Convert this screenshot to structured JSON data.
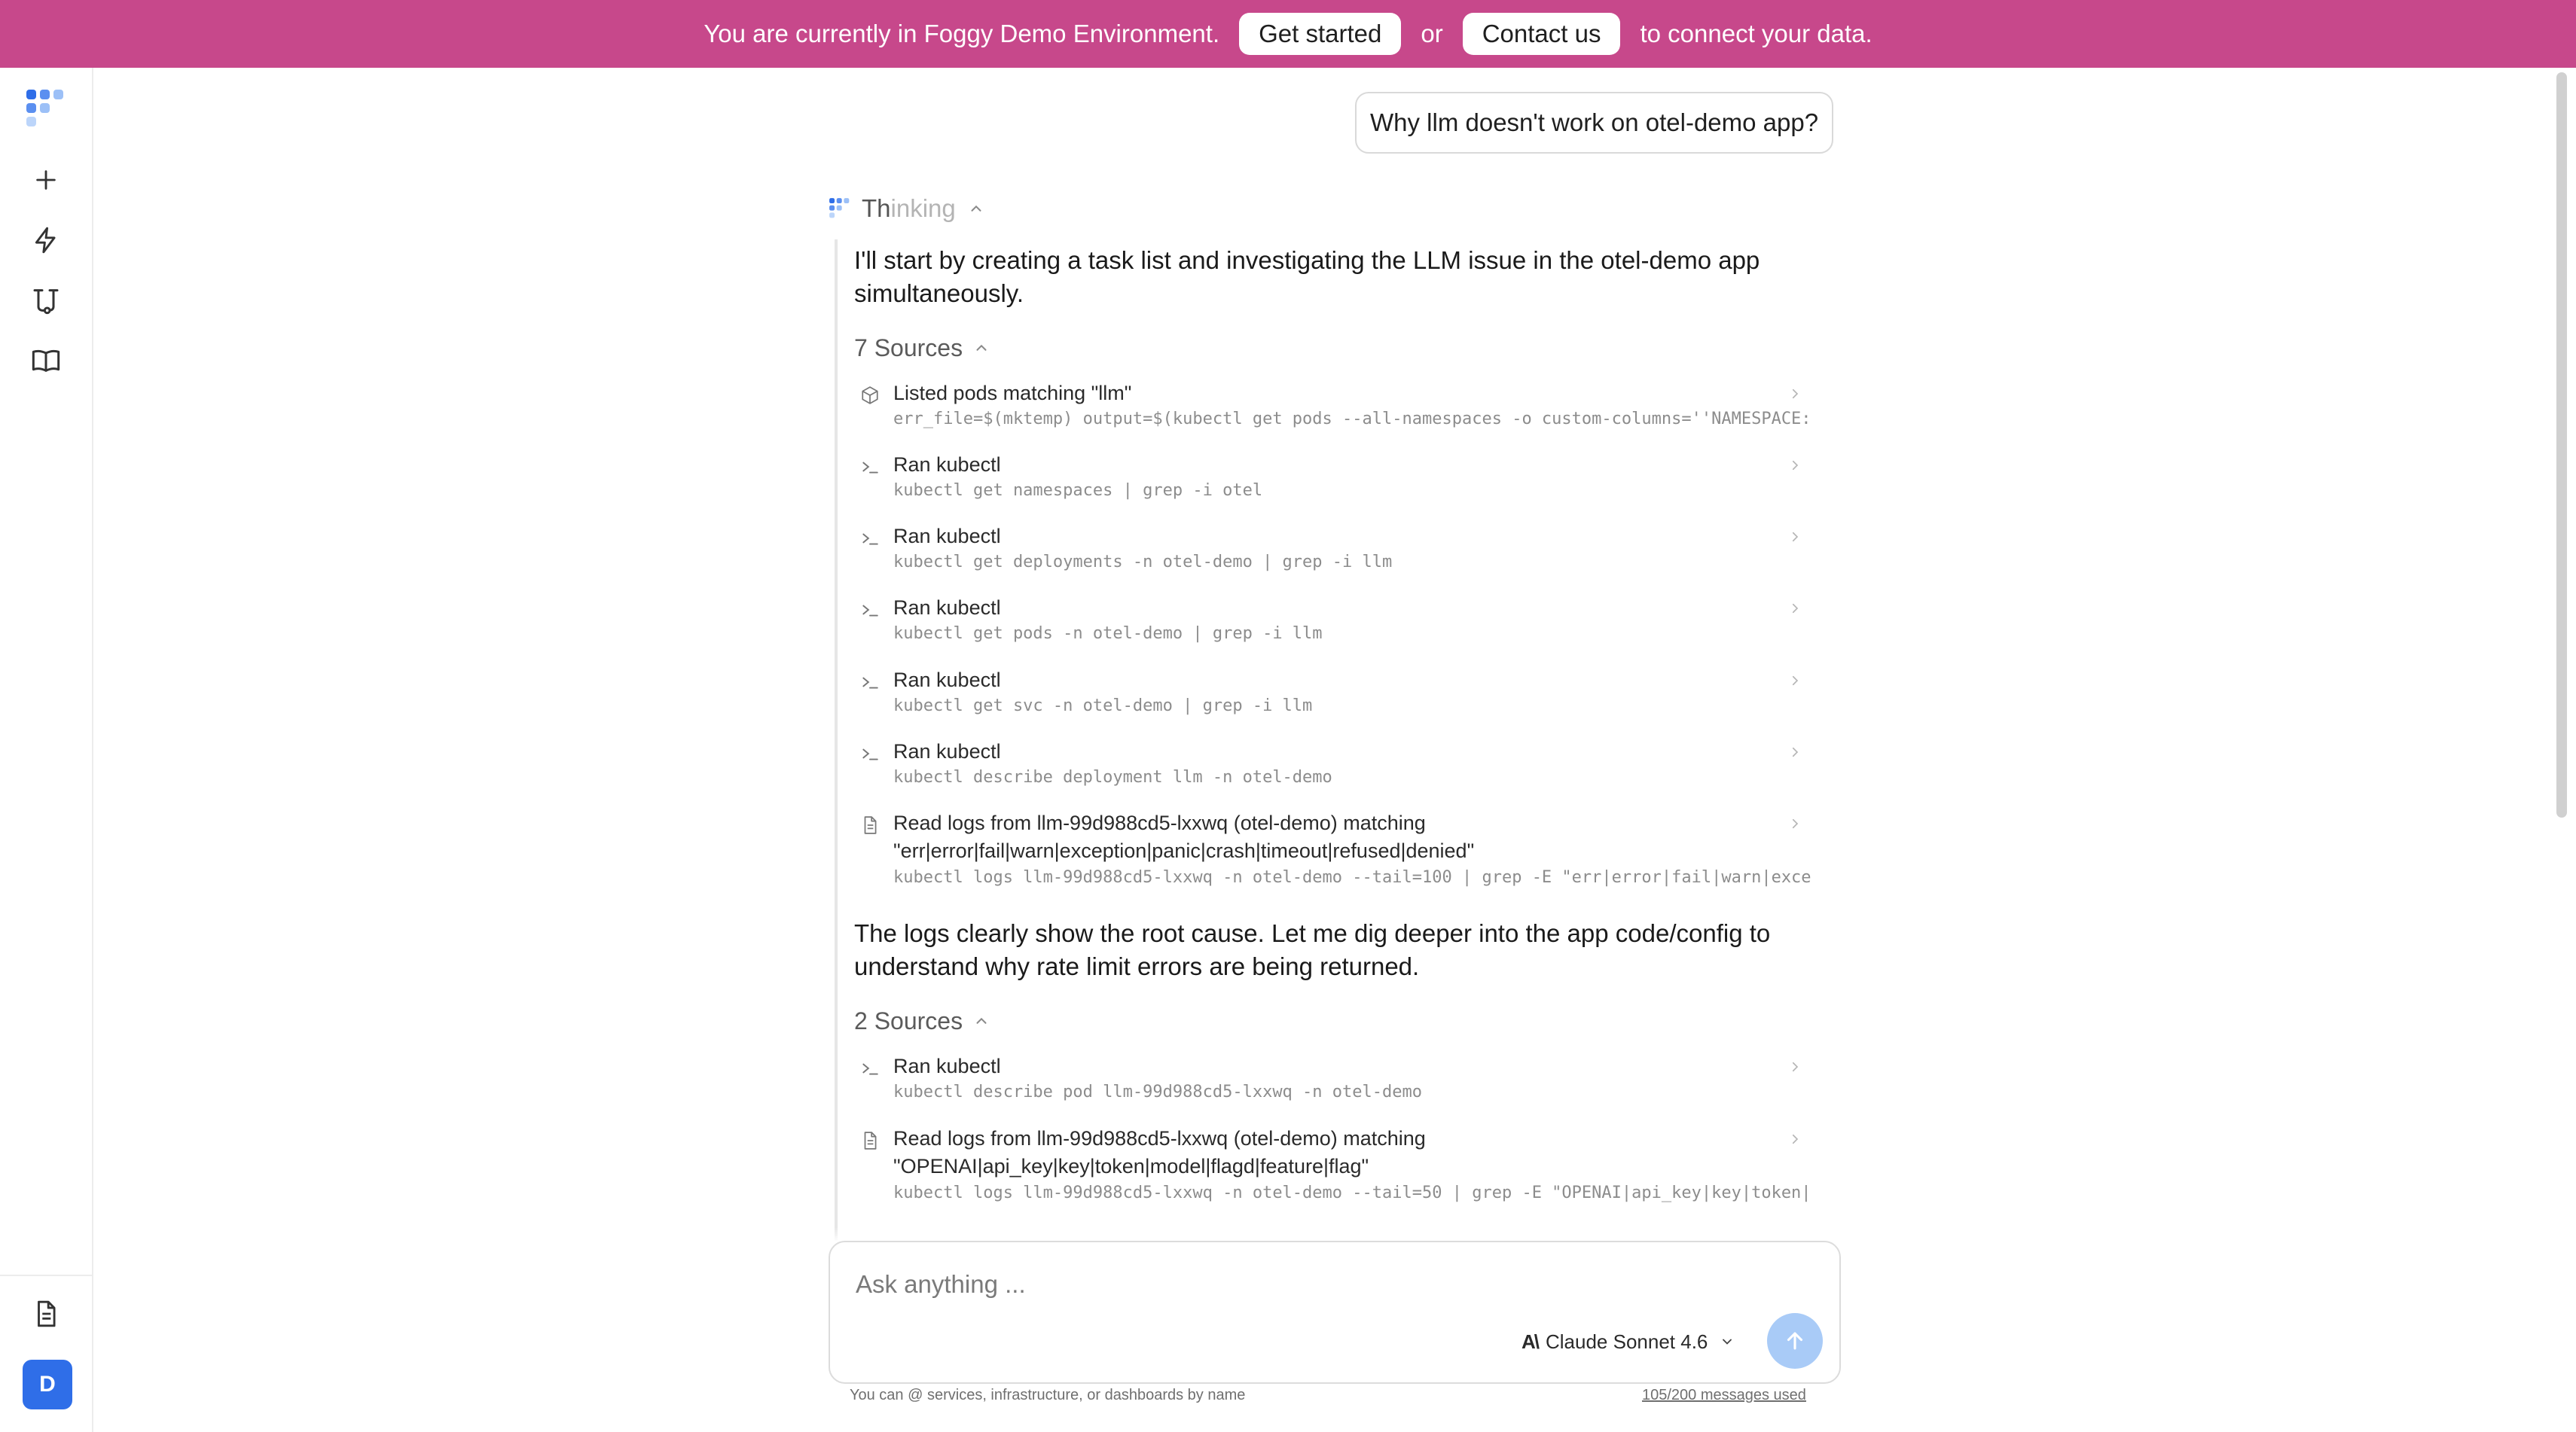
{
  "banner": {
    "text_before": "You are currently in Foggy Demo Environment.",
    "get_started": "Get started",
    "or": "or",
    "contact_us": "Contact us",
    "text_after": "to connect your data."
  },
  "sidebar": {
    "icons": [
      "foggy-logo-icon",
      "plus-icon",
      "lightning-icon",
      "workflow-icon",
      "book-icon",
      "document-icon"
    ],
    "avatar_initial": "D"
  },
  "conversation": {
    "user_message": "Why llm doesn't work on otel-demo app?",
    "thinking_prefix": "Th",
    "thinking_rest": "inking",
    "intro_line1": "I'll start by creating a task list and investigating the LLM issue in the otel-demo app",
    "intro_line2": "simultaneously.",
    "sources_group_1": {
      "label": "7 Sources",
      "items": [
        {
          "icon": "cube-icon",
          "title": "Listed pods matching \"llm\"",
          "command": "err_file=$(mktemp) output=$(kubectl get pods --all-namespaces -o custom-columns=''NAMESPACE:.metadata.namespace,NAME:.metadata.name''"
        },
        {
          "icon": "terminal-icon",
          "title": "Ran kubectl",
          "command": "kubectl get namespaces | grep -i otel"
        },
        {
          "icon": "terminal-icon",
          "title": "Ran kubectl",
          "command": "kubectl get deployments -n otel-demo | grep -i llm"
        },
        {
          "icon": "terminal-icon",
          "title": "Ran kubectl",
          "command": "kubectl get pods -n otel-demo | grep -i llm"
        },
        {
          "icon": "terminal-icon",
          "title": "Ran kubectl",
          "command": "kubectl get svc -n otel-demo | grep -i llm"
        },
        {
          "icon": "terminal-icon",
          "title": "Ran kubectl",
          "command": "kubectl describe deployment llm -n otel-demo"
        },
        {
          "icon": "file-icon",
          "title": "Read logs from llm-99d988cd5-lxxwq (otel-demo) matching",
          "title2": "\"err|error|fail|warn|exception|panic|crash|timeout|refused|denied\"",
          "command": "kubectl logs llm-99d988cd5-lxxwq -n otel-demo --tail=100 | grep -E \"err|error|fail|warn|exception|panic|crash|timeout|refused|denied\""
        }
      ]
    },
    "mid_line1": "The logs clearly show the root cause. Let me dig deeper into the app code/config to",
    "mid_line2": "understand why rate limit errors are being returned.",
    "sources_group_2": {
      "label": "2 Sources",
      "items": [
        {
          "icon": "terminal-icon",
          "title": "Ran kubectl",
          "command": "kubectl describe pod llm-99d988cd5-lxxwq -n otel-demo"
        },
        {
          "icon": "file-icon",
          "title": "Read logs from llm-99d988cd5-lxxwq (otel-demo) matching",
          "title2": "\"OPENAI|api_key|key|token|model|flagd|feature|flag\"",
          "command": "kubectl logs llm-99d988cd5-lxxwq -n otel-demo --tail=50 | grep -E \"OPENAI|api_key|key|token|model|flagd|feature|flag\""
        }
      ]
    }
  },
  "composer": {
    "placeholder": "Ask anything ...",
    "model_name": "Claude Sonnet 4.6",
    "hint": "You can @ services, infrastructure, or dashboards by name",
    "usage": "105/200 messages used"
  },
  "colors": {
    "banner": "#c7488b",
    "accent": "#2f6ee8",
    "send_button": "#a9cbf7"
  }
}
